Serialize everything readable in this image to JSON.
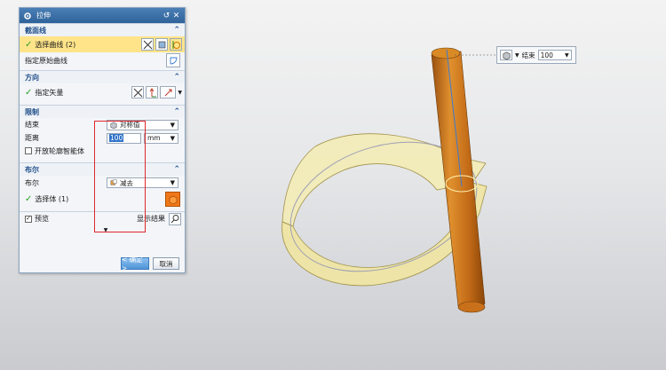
{
  "dialog": {
    "title": "拉伸",
    "sections": {
      "section_curve": {
        "header": "截面线",
        "select_curve": "选择曲线 (2)",
        "specify_origin": "指定原始曲线"
      },
      "direction": {
        "header": "方向",
        "specify_vector": "指定矢量"
      },
      "limits": {
        "header": "限制",
        "end_label": "结束",
        "end_value": "对称值",
        "distance_label": "距离",
        "distance_value": "100",
        "distance_unit": "mm",
        "open_profile": "开放轮廓智能体"
      },
      "boolean": {
        "header": "布尔",
        "boolean_label": "布尔",
        "boolean_value": "减去",
        "select_body": "选择体 (1)"
      }
    },
    "preview": {
      "label": "预览",
      "checked": true,
      "show_result": "显示结果"
    },
    "buttons": {
      "ok": "< 确定 >",
      "cancel": "取消"
    }
  },
  "mini_toolbar": {
    "end_label": "结束",
    "value": "100"
  },
  "icons": {
    "title": "gear-icon",
    "curve": "curve-rule-icon",
    "origin": "origin-curve-icon",
    "vector": "vector-icon",
    "body": "solid-body-icon",
    "preview_search": "magnifier-icon"
  },
  "colors": {
    "section_header": "#1f4e8a",
    "highlight": "#ffe48a",
    "check": "#2aa02a",
    "callout": "#e0262c",
    "rod": "#c8701a",
    "sheet": "#f2e8a8"
  }
}
